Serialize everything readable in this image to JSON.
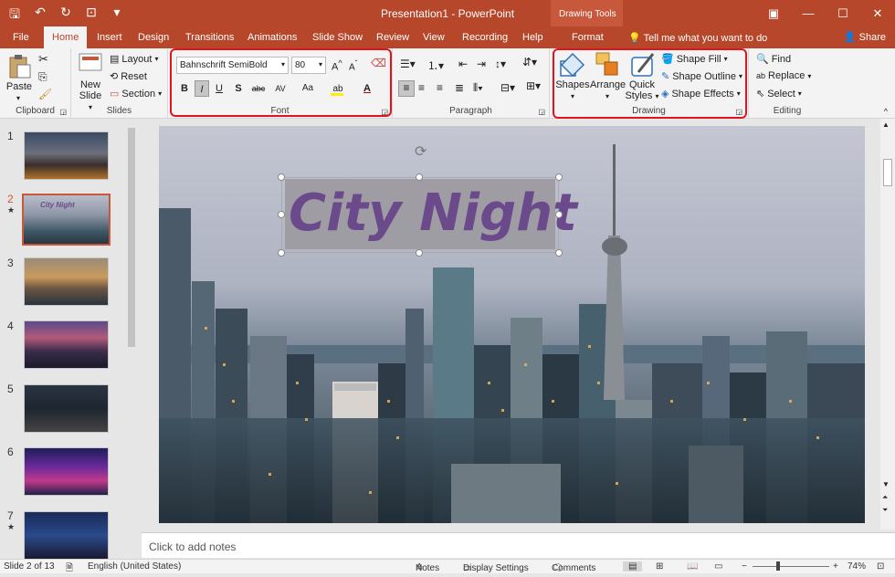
{
  "window": {
    "doc_title": "Presentation1",
    "app_title": "PowerPoint",
    "title_separator": " - ",
    "contextual_tab_group": "Drawing Tools"
  },
  "tabs": [
    "File",
    "Home",
    "Insert",
    "Design",
    "Transitions",
    "Animations",
    "Slide Show",
    "Review",
    "View",
    "Recording",
    "Help",
    "Format"
  ],
  "tell_me": "Tell me what you want to do",
  "share": "Share",
  "ribbon": {
    "clipboard": {
      "label": "Clipboard",
      "paste": "Paste"
    },
    "slides": {
      "label": "Slides",
      "new_slide_line1": "New",
      "new_slide_line2": "Slide",
      "layout": "Layout",
      "reset": "Reset",
      "section": "Section"
    },
    "font": {
      "label": "Font",
      "family": "Bahnschrift SemiBold",
      "size": "80",
      "bold": "B",
      "italic": "I",
      "underline": "U",
      "shadow": "S",
      "strike": "abc",
      "spacing": "AV",
      "case": "Aa",
      "color": "A"
    },
    "paragraph": {
      "label": "Paragraph"
    },
    "drawing": {
      "label": "Drawing",
      "shapes": "Shapes",
      "arrange": "Arrange",
      "quick_styles_line1": "Quick",
      "quick_styles_line2": "Styles",
      "shape_fill": "Shape Fill",
      "shape_outline": "Shape Outline",
      "shape_effects": "Shape Effects"
    },
    "editing": {
      "label": "Editing",
      "find": "Find",
      "replace": "Replace",
      "select": "Select"
    }
  },
  "thumbnails": [
    {
      "num": "1",
      "star": "",
      "caption": ""
    },
    {
      "num": "2",
      "star": "★",
      "caption": "City Night"
    },
    {
      "num": "3",
      "star": "",
      "caption": ""
    },
    {
      "num": "4",
      "star": "",
      "caption": ""
    },
    {
      "num": "5",
      "star": "",
      "caption": ""
    },
    {
      "num": "6",
      "star": "",
      "caption": ""
    },
    {
      "num": "7",
      "star": "★",
      "caption": ""
    }
  ],
  "slide": {
    "title": "City Night"
  },
  "notes_placeholder": "Click to add notes",
  "status": {
    "slide_info": "Slide 2 of 13",
    "language": "English (United States)",
    "notes": "Notes",
    "display_settings": "Display Settings",
    "comments": "Comments",
    "zoom": "74%"
  },
  "colors": {
    "accent": "#b7472a",
    "highlight_box": "#e0141e",
    "title_text": "#6b4a8c",
    "title_box": "#9c9aa0"
  }
}
